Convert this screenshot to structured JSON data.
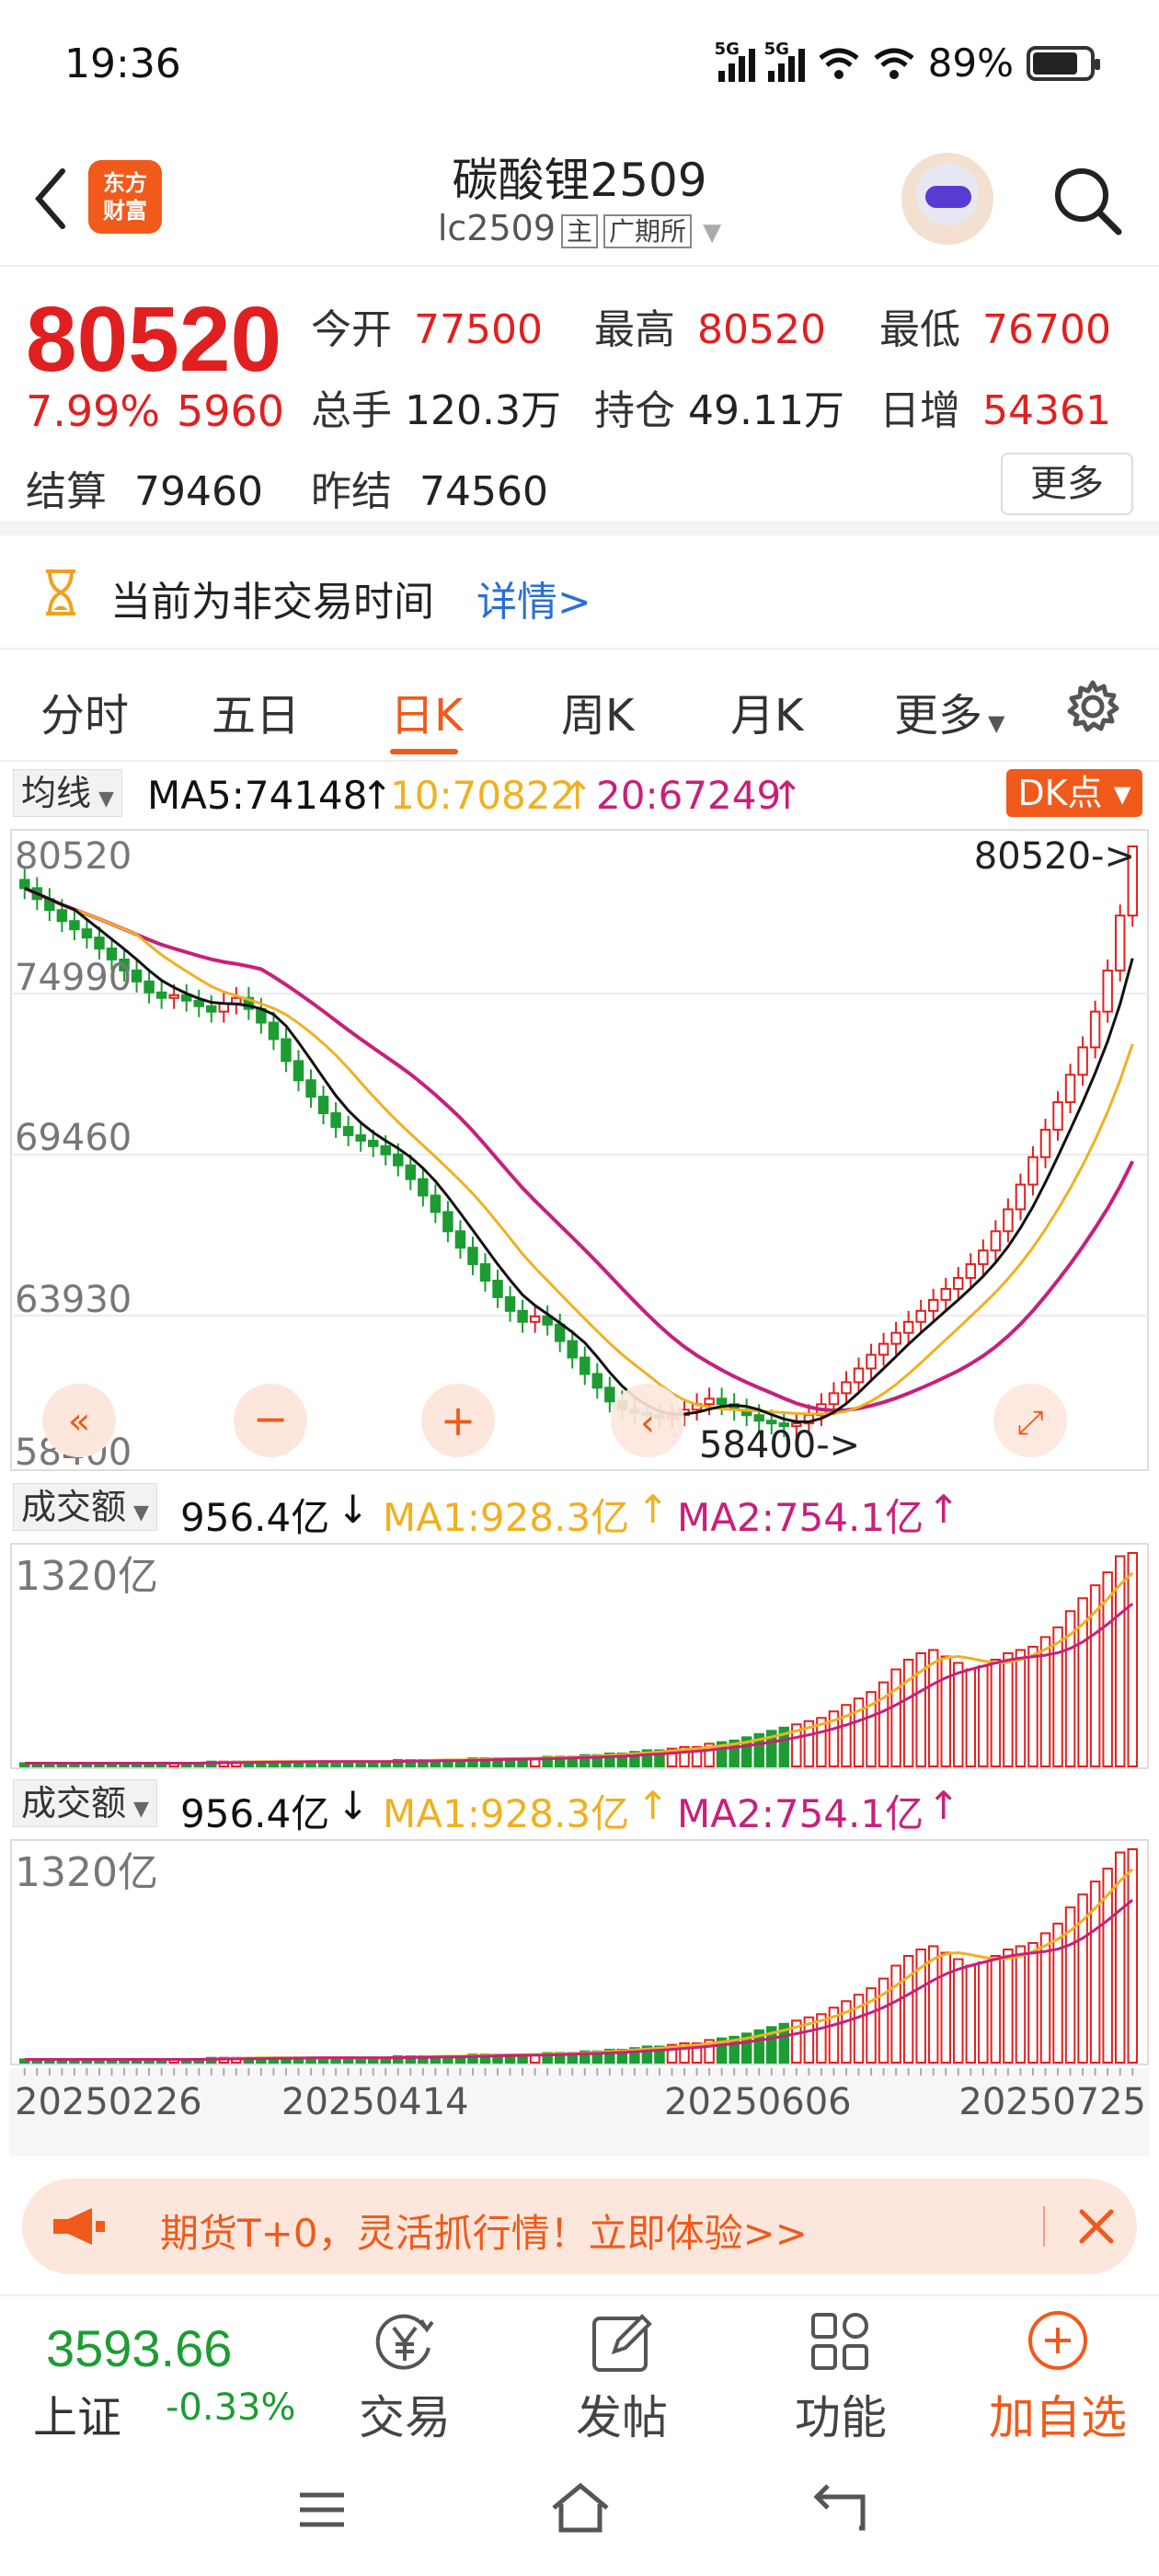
{
  "status": {
    "time": "19:36",
    "net1": "5G",
    "net2": "5G",
    "battery": "89%"
  },
  "header": {
    "logo_line1": "东方",
    "logo_line2": "财富",
    "title": "碳酸锂2509",
    "code": "lc2509",
    "badge_main": "主",
    "badge_exchange": "广期所"
  },
  "quote": {
    "price": "80520",
    "change_pct": "7.99%",
    "change": "5960",
    "open_label": "今开",
    "open": "77500",
    "high_label": "最高",
    "high": "80520",
    "low_label": "最低",
    "low": "76700",
    "volume_label": "总手",
    "volume": "120.3万",
    "oi_label": "持仓",
    "oi": "49.11万",
    "daily_inc_label": "日增",
    "daily_inc": "54361",
    "settle_label": "结算",
    "settle": "79460",
    "prev_settle_label": "昨结",
    "prev_settle": "74560",
    "more": "更多"
  },
  "notice": {
    "text": "当前为非交易时间",
    "link": "详情>"
  },
  "tabs": [
    "分时",
    "五日",
    "日K",
    "周K",
    "月K",
    "更多"
  ],
  "active_tab": 2,
  "ma_row": {
    "selector": "均线",
    "ma5": "MA5:74148",
    "ma10": "10:70822",
    "ma20": "20:67249",
    "dk": "DK点"
  },
  "price_axis": [
    "80520",
    "74990",
    "69460",
    "63930",
    "58400"
  ],
  "high_marker": "80520->",
  "low_marker": "58400->",
  "volume_rows": [
    {
      "selector": "成交额",
      "value": "956.4亿",
      "ma1": "MA1:928.3亿",
      "ma2": "MA2:754.1亿",
      "axis_top": "1320亿"
    },
    {
      "selector": "成交额",
      "value": "956.4亿",
      "ma1": "MA1:928.3亿",
      "ma2": "MA2:754.1亿",
      "axis_top": "1320亿"
    }
  ],
  "dates": [
    "20250226",
    "20250414",
    "20250606",
    "20250725"
  ],
  "ad": {
    "text": "期货T+0，灵活抓行情！立即体验>>"
  },
  "bottom_bar": {
    "index_value": "3593.66",
    "index_name": "上证",
    "index_pct": "-0.33%",
    "trade": "交易",
    "post": "发帖",
    "functions": "功能",
    "add_watch": "加自选"
  },
  "colors": {
    "up": "#e02020",
    "down": "#1c9c32",
    "accent": "#f05a1a",
    "ma5": "#111111",
    "ma10": "#f0b020",
    "ma20": "#c8207a"
  },
  "chart_data": {
    "type": "candlestick",
    "ylim": [
      58400,
      80520
    ],
    "xlabels": [
      "20250226",
      "20250414",
      "20250606",
      "20250725"
    ],
    "close_series": [
      79000,
      78600,
      78200,
      77800,
      77500,
      77200,
      76800,
      76400,
      76000,
      75600,
      75200,
      75000,
      75100,
      74900,
      74700,
      74500,
      74800,
      75000,
      74600,
      74100,
      73500,
      72700,
      72000,
      71400,
      70800,
      70300,
      70000,
      69800,
      69600,
      69300,
      68900,
      68400,
      67800,
      67200,
      66500,
      65900,
      65300,
      64700,
      64100,
      63600,
      63200,
      63400,
      63100,
      62500,
      61900,
      61300,
      60800,
      60300,
      60000,
      59900,
      59800,
      59700,
      59800,
      60000,
      60200,
      60400,
      60200,
      60000,
      59800,
      59600,
      59500,
      59400,
      59500,
      59800,
      60200,
      60600,
      61000,
      61500,
      62000,
      62400,
      62800,
      63200,
      63600,
      64000,
      64400,
      64800,
      65300,
      65800,
      66500,
      67300,
      68200,
      69200,
      70200,
      71200,
      72200,
      73200,
      74500,
      76000,
      78000,
      80520
    ],
    "volume_series": [
      2,
      2,
      2,
      2,
      2,
      2,
      2,
      2,
      2,
      2,
      2,
      2,
      2,
      2,
      2,
      3,
      3,
      3,
      3,
      3,
      3,
      3,
      3,
      3,
      3,
      3,
      3,
      3,
      3,
      3,
      4,
      4,
      4,
      4,
      4,
      4,
      5,
      5,
      5,
      5,
      5,
      5,
      6,
      6,
      6,
      7,
      7,
      8,
      8,
      9,
      10,
      10,
      11,
      12,
      12,
      14,
      15,
      16,
      18,
      20,
      22,
      24,
      26,
      28,
      30,
      34,
      38,
      42,
      46,
      52,
      60,
      66,
      70,
      72,
      68,
      64,
      60,
      62,
      66,
      70,
      72,
      74,
      80,
      86,
      96,
      104,
      112,
      120,
      130,
      132
    ],
    "ma5_last": 74148,
    "ma10_last": 70822,
    "ma20_last": 67249
  }
}
